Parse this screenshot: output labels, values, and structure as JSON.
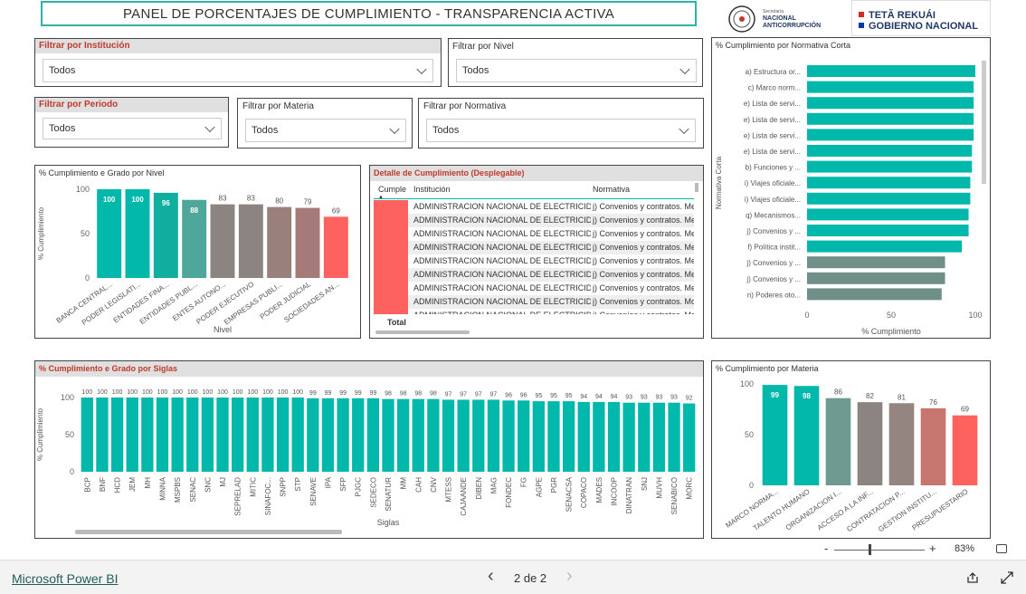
{
  "header": {
    "title": "PANEL DE PORCENTAJES DE CUMPLIMIENTO - TRANSPARENCIA ACTIVA",
    "logo1_small": "Secretaría",
    "logo1_line1": "NACIONAL",
    "logo1_line2": "ANTICORRUPCIÓN",
    "logo2_line1": "TETÃ REKUÁI",
    "logo2_line2": "GOBIERNO NACIONAL"
  },
  "filters": {
    "institucion": {
      "label": "Filtrar por Institución",
      "value": "Todos"
    },
    "nivel": {
      "label": "Filtrar por Nivel",
      "value": "Todos"
    },
    "periodo": {
      "label": "Filtrar por Periodo",
      "value": "Todos"
    },
    "materia": {
      "label": "Filtrar por Materia",
      "value": "Todos"
    },
    "normativa": {
      "label": "Filtrar por Normativa",
      "value": "Todos"
    }
  },
  "colors": {
    "teal": "#01b8aa",
    "teal_dark": "#4fa69a",
    "gray": "#8c8480",
    "rose": "#a77a7a",
    "red": "#fd625e",
    "accent_title": "#c0392b",
    "banner_border": "#2cb5a5"
  },
  "detail_table": {
    "title": "Detalle de Cumplimiento (Desplegable)",
    "columns": [
      "Cumple",
      "Institución",
      "Normativa"
    ],
    "rows": [
      {
        "inst": "ADMINISTRACION NACIONAL DE ELECTRICIDAD",
        "norm": "j) Convenios y contratos. Me"
      },
      {
        "inst": "ADMINISTRACION NACIONAL DE ELECTRICIDAD",
        "norm": "j) Convenios y contratos. Me"
      },
      {
        "inst": "ADMINISTRACION NACIONAL DE ELECTRICIDAD",
        "norm": "j) Convenios y contratos. Me"
      },
      {
        "inst": "ADMINISTRACION NACIONAL DE ELECTRICIDAD",
        "norm": "j) Convenios y contratos. Me"
      },
      {
        "inst": "ADMINISTRACION NACIONAL DE ELECTRICIDAD",
        "norm": "j) Convenios y contratos. Me"
      },
      {
        "inst": "ADMINISTRACION NACIONAL DE ELECTRICIDAD",
        "norm": "j) Convenios y contratos. Me"
      },
      {
        "inst": "ADMINISTRACION NACIONAL DE ELECTRICIDAD",
        "norm": "j) Convenios y contratos. Me"
      },
      {
        "inst": "ADMINISTRACION NACIONAL DE ELECTRICIDAD",
        "norm": "j) Convenios y contratos. Mo"
      },
      {
        "inst": "ADMINISTRACION NACIONAL DE ELECTRICIDAD",
        "norm": "j) Convenios y contratos. Me"
      }
    ],
    "total_label": "Total"
  },
  "footer": {
    "brand": "Microsoft Power BI",
    "page_indicator": "2 de 2",
    "zoom_minus": "-",
    "zoom_plus": "+",
    "zoom_level": "83%",
    "prev_glyph": "‹",
    "next_glyph": "›"
  },
  "chart_data": [
    {
      "id": "nivel",
      "type": "bar",
      "title": "% Cumplimiento e Grado por Nivel",
      "xlabel": "Nivel",
      "ylabel": "% Cumplimiento",
      "ylim": [
        0,
        100
      ],
      "yticks": [
        0,
        50,
        100
      ],
      "categories": [
        "BANCA CENTRAL...",
        "PODER LEGISLATI...",
        "ENTIDADES FINA...",
        "ENTIDADES PUBL...",
        "ENTES AUTONO...",
        "PODER EJECUTIVO",
        "EMPRESAS PUBLI...",
        "PODER JUDICIAL",
        "SOCIEDADES AN..."
      ],
      "values": [
        100,
        100,
        96,
        88,
        83,
        83,
        80,
        79,
        69
      ],
      "colors": [
        "#01b8aa",
        "#01b8aa",
        "#0fae9f",
        "#4fa69a",
        "#8c8480",
        "#8c8480",
        "#9a807d",
        "#a77a7a",
        "#fd625e"
      ],
      "grid": false
    },
    {
      "id": "normativa",
      "type": "bar",
      "orientation": "horizontal",
      "title": "% Cumplimiento por Normativa Corta",
      "xlabel": "% Cumplimiento",
      "ylabel": "Normativa Corta",
      "xlim": [
        0,
        100
      ],
      "xticks": [
        0,
        50,
        100
      ],
      "categories": [
        "a) Estructura or...",
        "c) Marco norm...",
        "e) Lista de servi...",
        "e) Lista de servi...",
        "e) Lista de servi...",
        "e) Lista de servi...",
        "b) Funciones y ...",
        "i) Viajes oficiale...",
        "i) Viajes oficiale...",
        "q) Mecanismos...",
        "j) Convenios y ...",
        "f) Política instit...",
        "j) Convenios y ...",
        "j) Convenios y ...",
        "n) Poderes oto..."
      ],
      "values": [
        100,
        99,
        99,
        99,
        99,
        98,
        98,
        97,
        97,
        96,
        96,
        92,
        82,
        82,
        80
      ],
      "colors": [
        "#01b8aa",
        "#01b8aa",
        "#01b8aa",
        "#01b8aa",
        "#01b8aa",
        "#01b8aa",
        "#01b8aa",
        "#01b8aa",
        "#01b8aa",
        "#01b8aa",
        "#01b8aa",
        "#01b8aa",
        "#6f8f88",
        "#6f8f88",
        "#6f8f88"
      ],
      "grid": false
    },
    {
      "id": "siglas",
      "type": "bar",
      "title": "% Cumplimiento e Grado por Siglas",
      "xlabel": "Siglas",
      "ylabel": "% Cumplimiento",
      "ylim": [
        0,
        100
      ],
      "yticks": [
        0,
        50,
        100
      ],
      "categories": [
        "BCP",
        "BNF",
        "HCD",
        "JEM",
        "MH",
        "MINNA",
        "MSPBS",
        "SENAC",
        "SNC",
        "MJ",
        "SEPRELAD",
        "MITIC",
        "SINAFOC...",
        "SNPP",
        "STP",
        "SENAVE",
        "IPA",
        "SFP",
        "PJGC",
        "SEDECO",
        "SENATUR",
        "MM",
        "CAH",
        "CNV",
        "MTESS",
        "CAJAANDE",
        "DIBEN",
        "MAG",
        "FONDEC",
        "FG",
        "AGPE",
        "PGR",
        "SENACSA",
        "COPACO",
        "MADES",
        "INCOOP",
        "DINATRAN",
        "SNJ",
        "MUVH",
        "SENABICO",
        "MORC"
      ],
      "values": [
        100,
        100,
        100,
        100,
        100,
        100,
        100,
        100,
        100,
        100,
        100,
        100,
        100,
        100,
        100,
        99,
        99,
        99,
        99,
        99,
        98,
        98,
        98,
        98,
        97,
        97,
        97,
        97,
        96,
        96,
        95,
        95,
        95,
        94,
        94,
        94,
        93,
        93,
        93,
        93,
        92
      ],
      "color": "#01b8aa",
      "grid": false
    },
    {
      "id": "materia",
      "type": "bar",
      "title": "% Cumplimiento por Materia",
      "ylim": [
        0,
        100
      ],
      "yticks": [
        0,
        50,
        100
      ],
      "categories": [
        "MARCO NORMA...",
        "TALENTO HUMANO",
        "ORGANIZACION I...",
        "ACCESO A LA INF...",
        "CONTRATACION P...",
        "GESTION INSTITU...",
        "PRESUPUESTARIO"
      ],
      "values": [
        99,
        98,
        86,
        82,
        81,
        76,
        69
      ],
      "colors": [
        "#01b8aa",
        "#01b8aa",
        "#6f9a90",
        "#8c8480",
        "#958580",
        "#c7766f",
        "#fd625e"
      ],
      "grid": false
    }
  ]
}
